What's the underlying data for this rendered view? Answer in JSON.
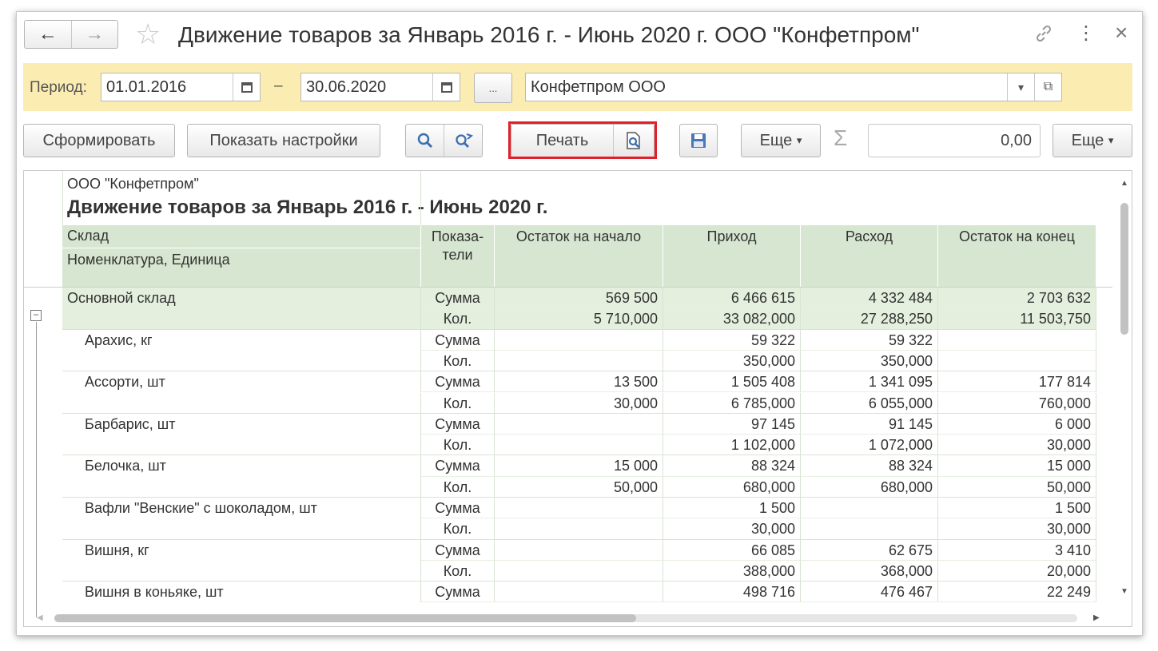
{
  "window": {
    "title": "Движение товаров  за Январь 2016 г. - Июнь 2020 г. ООО \"Конфетпром\"",
    "back_icon": "←",
    "forward_icon": "→",
    "star_icon": "☆",
    "link_icon": "🔗",
    "menu_icon": "⋮",
    "close_icon": "×"
  },
  "period": {
    "label": "Период:",
    "from": "01.01.2016",
    "dash": "–",
    "to": "30.06.2020",
    "ellipsis": "...",
    "organization": "Конфетпром ООО",
    "dropdown_icon": "▾",
    "open_icon": "⧉"
  },
  "toolbar": {
    "generate": "Сформировать",
    "show_settings": "Показать настройки",
    "print": "Печать",
    "more1": "Еще",
    "more2": "Еще",
    "sum_value": "0,00",
    "sigma": "Σ",
    "dropdown_arrow": "▾"
  },
  "report": {
    "company": "ООО \"Конфетпром\"",
    "title": "Движение товаров  за Январь 2016 г. - Июнь 2020 г.",
    "headers": {
      "warehouse": "Склад",
      "item_unit": "Номенклатура, Единица",
      "indicators_1": "Показа-",
      "indicators_2": "тели",
      "opening": "Остаток на начало",
      "income": "Приход",
      "expense": "Расход",
      "closing": "Остаток на конец"
    },
    "group_toggle": "⊟",
    "rows": [
      {
        "name": "Основной склад",
        "ind": "Сумма",
        "open": "569 500",
        "in": "6 466 615",
        "out": "4 332 484",
        "close": "2 703 632"
      },
      {
        "name": "",
        "ind": "Кол.",
        "open": "5 710,000",
        "in": "33 082,000",
        "out": "27 288,250",
        "close": "11 503,750"
      },
      {
        "name": "Арахис, кг",
        "ind": "Сумма",
        "open": "",
        "in": "59 322",
        "out": "59 322",
        "close": ""
      },
      {
        "name": "",
        "ind": "Кол.",
        "open": "",
        "in": "350,000",
        "out": "350,000",
        "close": ""
      },
      {
        "name": "Ассорти, шт",
        "ind": "Сумма",
        "open": "13 500",
        "in": "1 505 408",
        "out": "1 341 095",
        "close": "177 814"
      },
      {
        "name": "",
        "ind": "Кол.",
        "open": "30,000",
        "in": "6 785,000",
        "out": "6 055,000",
        "close": "760,000"
      },
      {
        "name": "Барбарис, шт",
        "ind": "Сумма",
        "open": "",
        "in": "97 145",
        "out": "91 145",
        "close": "6 000"
      },
      {
        "name": "",
        "ind": "Кол.",
        "open": "",
        "in": "1 102,000",
        "out": "1 072,000",
        "close": "30,000"
      },
      {
        "name": "Белочка, шт",
        "ind": "Сумма",
        "open": "15 000",
        "in": "88 324",
        "out": "88 324",
        "close": "15 000"
      },
      {
        "name": "",
        "ind": "Кол.",
        "open": "50,000",
        "in": "680,000",
        "out": "680,000",
        "close": "50,000"
      },
      {
        "name": "Вафли \"Венские\" с шоколадом, шт",
        "ind": "Сумма",
        "open": "",
        "in": "1 500",
        "out": "",
        "close": "1 500"
      },
      {
        "name": "",
        "ind": "Кол.",
        "open": "",
        "in": "30,000",
        "out": "",
        "close": "30,000"
      },
      {
        "name": "Вишня, кг",
        "ind": "Сумма",
        "open": "",
        "in": "66 085",
        "out": "62 675",
        "close": "3 410"
      },
      {
        "name": "",
        "ind": "Кол.",
        "open": "",
        "in": "388,000",
        "out": "368,000",
        "close": "20,000"
      },
      {
        "name": "Вишня в коньяке, шт",
        "ind": "Сумма",
        "open": "",
        "in": "498 716",
        "out": "476 467",
        "close": "22 249"
      }
    ]
  }
}
